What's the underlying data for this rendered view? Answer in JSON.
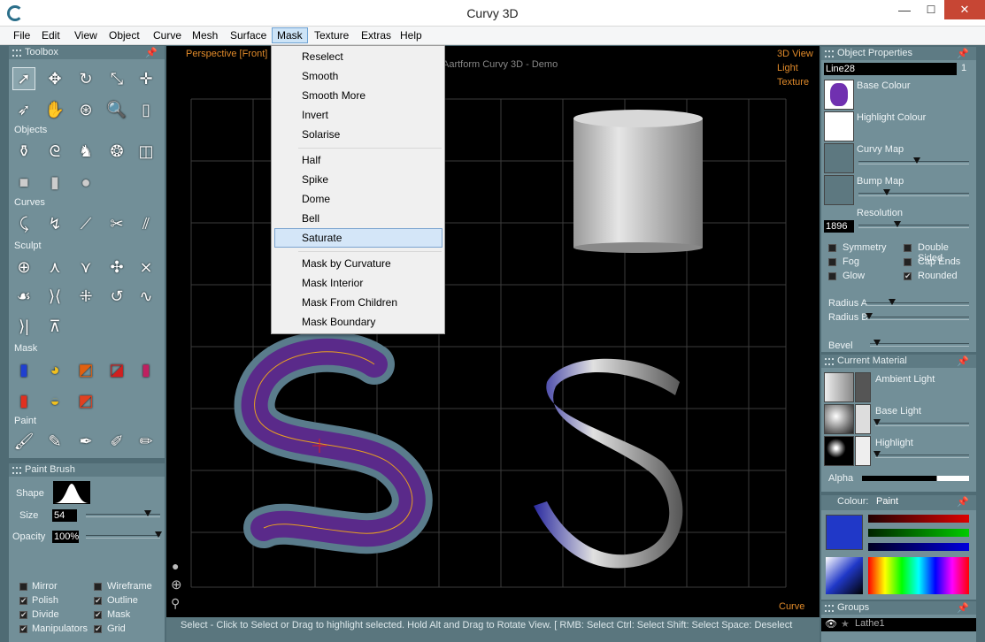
{
  "window": {
    "title": "Curvy 3D",
    "min": "—",
    "max": "☐",
    "close": "✕"
  },
  "menu": [
    "File",
    "Edit",
    "View",
    "Object",
    "Curve",
    "Mesh",
    "Surface",
    "Mask",
    "Texture",
    "Extras",
    "Help"
  ],
  "mask_menu": {
    "items": [
      "Reselect",
      "Smooth",
      "Smooth More",
      "Invert",
      "Solarise",
      "Half",
      "Spike",
      "Dome",
      "Bell",
      "Saturate",
      "Mask by Curvature",
      "Mask Interior",
      "Mask From Children",
      "Mask Boundary"
    ],
    "highlighted": "Saturate"
  },
  "toolbox": {
    "title": "Toolbox",
    "sections": {
      "objects": "Objects",
      "curves": "Curves",
      "sculpt": "Sculpt",
      "mask": "Mask",
      "paint": "Paint"
    }
  },
  "paint_brush": {
    "title": "Paint Brush",
    "shape_label": "Shape",
    "size_label": "Size",
    "size": "54",
    "opacity_label": "Opacity",
    "opacity": "100%",
    "options": [
      {
        "label": "Mirror",
        "checked": false
      },
      {
        "label": "Wireframe",
        "checked": false
      },
      {
        "label": "Polish",
        "checked": true
      },
      {
        "label": "Outline",
        "checked": true
      },
      {
        "label": "Divide",
        "checked": true
      },
      {
        "label": "Mask",
        "checked": true
      },
      {
        "label": "Manipulators",
        "checked": true
      },
      {
        "label": "Grid",
        "checked": true
      }
    ]
  },
  "viewport": {
    "view_name": "Perspective [Front]",
    "watermark": "Aartform Curvy 3D - Demo",
    "mode_3d": "3D View",
    "mode_light": "Light",
    "mode_texture": "Texture",
    "mode_curve": "Curve"
  },
  "object_properties": {
    "title": "Object Properties",
    "name": "Line28",
    "count": "1",
    "base_colour": "Base Colour",
    "highlight_colour": "Highlight Colour",
    "curvy_map": "Curvy Map",
    "bump_map": "Bump Map",
    "resolution_label": "Resolution",
    "resolution": "1896",
    "options": [
      {
        "label": "Symmetry",
        "checked": false
      },
      {
        "label": "Double Sided",
        "checked": false
      },
      {
        "label": "Fog",
        "checked": false
      },
      {
        "label": "Cap Ends",
        "checked": false
      },
      {
        "label": "Glow",
        "checked": false
      },
      {
        "label": "Rounded",
        "checked": true
      }
    ],
    "radius_a": "Radius A",
    "radius_b": "Radius B",
    "bevel": "Bevel"
  },
  "material": {
    "title": "Current Material",
    "ambient": "Ambient Light",
    "base": "Base Light",
    "highlight": "Highlight",
    "alpha": "Alpha"
  },
  "colour": {
    "title": "Colour:",
    "mode": "Paint",
    "current": "#2038c8"
  },
  "groups": {
    "title": "Groups",
    "item": "Lathe1"
  },
  "status": "Select - Click to Select or Drag to highlight selected. Hold Alt and Drag to Rotate View. [ RMB: Select   Ctrl: Select   Shift: Select   Space: Deselect"
}
